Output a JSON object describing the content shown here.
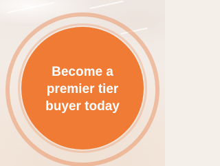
{
  "promo": {
    "headline_lines": [
      "Become a",
      "premier tier",
      "buyer today"
    ]
  },
  "colors": {
    "disc": "#f07b35",
    "ring": "#e98752",
    "text": "#ffffff",
    "background": "#f5efea"
  }
}
